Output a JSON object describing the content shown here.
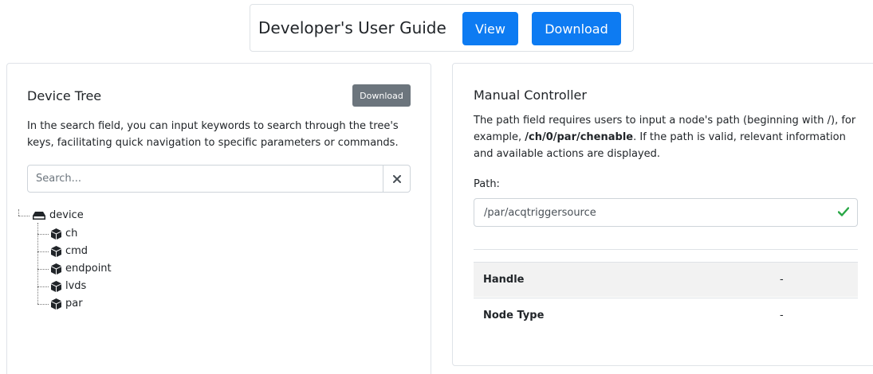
{
  "header": {
    "title": "Developer's User Guide",
    "view_label": "View",
    "download_label": "Download"
  },
  "device_tree": {
    "title": "Device Tree",
    "download_label": "Download",
    "description": "In the search field, you can input keywords to search through the tree's keys, facilitating quick navigation to specific parameters or commands.",
    "search": {
      "placeholder": "Search...",
      "value": ""
    },
    "clear_icon": "close-icon",
    "root": {
      "label": "device",
      "icon": "hard-drive-icon"
    },
    "children": [
      {
        "label": "ch",
        "icon": "cube-icon"
      },
      {
        "label": "cmd",
        "icon": "cube-icon"
      },
      {
        "label": "endpoint",
        "icon": "cube-icon"
      },
      {
        "label": "lvds",
        "icon": "cube-icon"
      },
      {
        "label": "par",
        "icon": "cube-icon"
      }
    ]
  },
  "manual_controller": {
    "title": "Manual Controller",
    "description_pre": "The path field requires users to input a node's path (beginning with /), for example, ",
    "description_bold": "/ch/0/par/chenable",
    "description_post": ". If the path is valid, relevant information and available actions are displayed.",
    "path_label": "Path:",
    "path_value": "/par/acqtriggersource",
    "valid_icon": "check-icon",
    "rows": [
      {
        "key": "Handle",
        "value": "-"
      },
      {
        "key": "Node Type",
        "value": "-"
      }
    ]
  },
  "colors": {
    "primary": "#0d7bf2",
    "secondary": "#6c757d",
    "success": "#28a745"
  }
}
